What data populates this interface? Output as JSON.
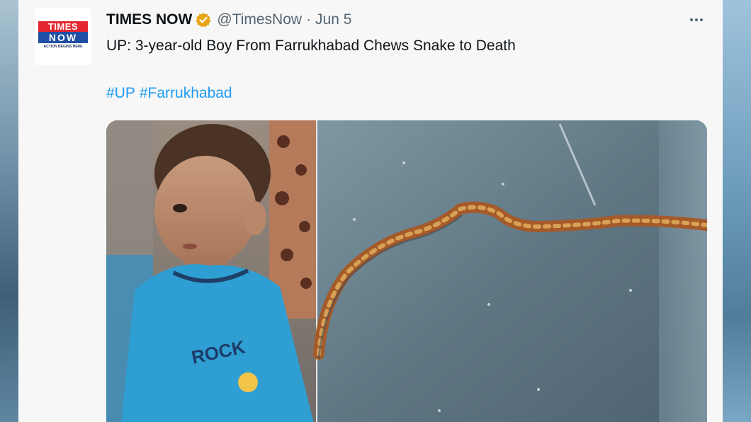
{
  "author": {
    "name": "TIMES NOW",
    "handle": "@TimesNow",
    "separator": "·",
    "date": "Jun 5",
    "verified_icon": "verified-badge-gold",
    "logo_line1": "TIMES",
    "logo_line2": "NOW",
    "logo_tagline": "ACTION BEGINS HERE"
  },
  "tweet": {
    "text": "UP: 3-year-old Boy From Farrukhabad Chews Snake to Death",
    "hashtags": [
      "#UP",
      "#Farrukhabad"
    ]
  },
  "menu_icon": "more-horizontal-icon",
  "media": {
    "left_image": "photo of toddler in blue t-shirt",
    "right_image": "photo of dead snake on stone floor",
    "shirt_text": "ROCK"
  },
  "colors": {
    "link": "#1d9bf0",
    "text": "#0f1419",
    "muted": "#536471",
    "badge": "#e8a517"
  }
}
